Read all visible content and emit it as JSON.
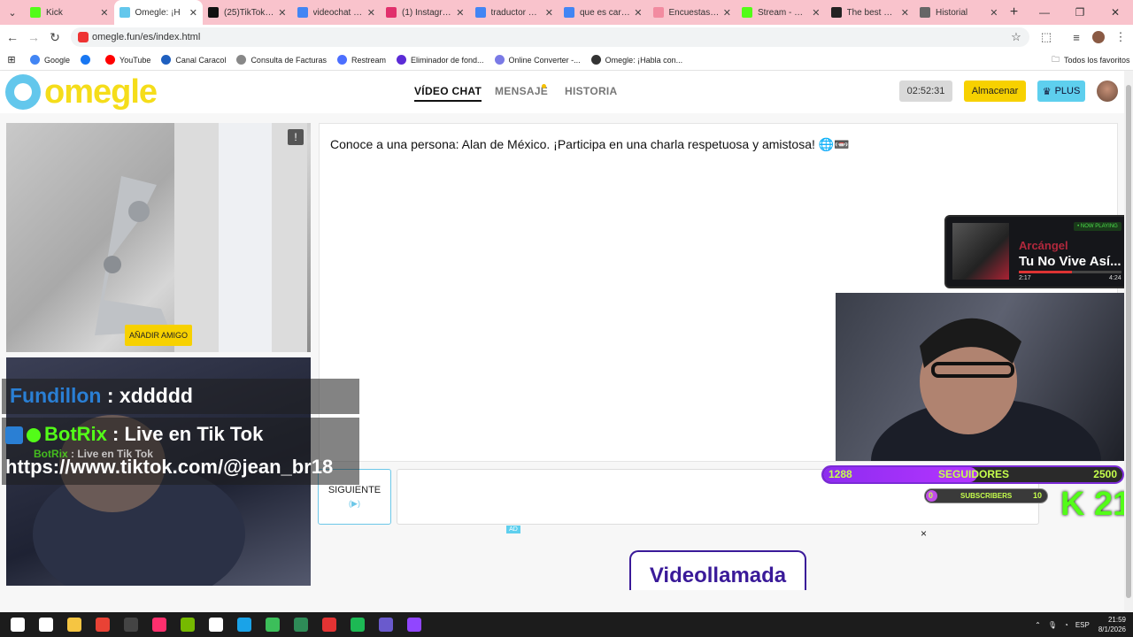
{
  "browser": {
    "tabs": [
      {
        "label": "Kick",
        "favicon_color": "#53fc18"
      },
      {
        "label": "Omegle: ¡H",
        "favicon_color": "#63c7ec",
        "active": true
      },
      {
        "label": "(25)TikTok - M",
        "favicon_color": "#111111"
      },
      {
        "label": "videochat - Bu",
        "favicon_color": "#4285f4"
      },
      {
        "label": "(1) Instagram",
        "favicon_color": "#e1306c"
      },
      {
        "label": "traductor de in",
        "favicon_color": "#4285f4"
      },
      {
        "label": "que es carbon",
        "favicon_color": "#4285f4"
      },
      {
        "label": "Encuestas en K",
        "favicon_color": "#f28ba0"
      },
      {
        "label": "Stream - Kick D",
        "favicon_color": "#53fc18"
      },
      {
        "label": "The best ChatB",
        "favicon_color": "#222222"
      },
      {
        "label": "Historial",
        "favicon_color": "#666666"
      }
    ],
    "url": "omegle.fun/es/index.html",
    "bookmarks": [
      {
        "label": "Google",
        "color": "#4285f4"
      },
      {
        "label": "",
        "color": "#1877f2"
      },
      {
        "label": "YouTube",
        "color": "#ff0000"
      },
      {
        "label": "Canal Caracol",
        "color": "#1f5fbf"
      },
      {
        "label": "Consulta de Facturas",
        "color": "#888888"
      },
      {
        "label": "Restream",
        "color": "#4c6fff"
      },
      {
        "label": "Eliminador de fond...",
        "color": "#5b2bd6"
      },
      {
        "label": "Online Converter -...",
        "color": "#7a7ae6"
      },
      {
        "label": "Omegle: ¡Habla con...",
        "color": "#333333"
      }
    ],
    "all_bookmarks_label": "Todos los favoritos"
  },
  "site": {
    "logo_text": "omegle",
    "nav": [
      {
        "label": "VÍDEO CHAT",
        "active": true
      },
      {
        "label": "MENSAJE",
        "active": false
      },
      {
        "label": "HISTORIA",
        "active": false
      }
    ],
    "timer": "02:52:31",
    "save_label": "Almacenar",
    "plus_label": "PLUS"
  },
  "chat": {
    "intro": "Conoce a una persona: Alan de México. ¡Participa en una charla respetuosa y amistosa! 🌐📼",
    "add_friend_label": "AÑADIR AMIGO",
    "next_label": "SIGUIENTE",
    "next_hint": "(▶)",
    "ad_tag": "AD",
    "ad_close": "×",
    "ad_text": "Videollamada"
  },
  "stream_overlay": {
    "chat_lines": [
      {
        "user": "Fundillon",
        "text": " : xddddd",
        "user_color": "#2a7fd4"
      },
      {
        "user": "BotRix",
        "text": " : Live en Tik Tok",
        "user_color": "#53fc18"
      },
      {
        "user": "BotRix",
        "text": " : Live en Tik Tok",
        "user_color": "#53fc18"
      },
      {
        "user": "",
        "text": "https://www.tiktok.com/@jean_br18",
        "user_color": "#ffffff"
      }
    ],
    "now_playing": {
      "tag": "• NOW PLAYING",
      "artist": "Arcángel",
      "title": "Tu No Vive Así...",
      "elapsed": "2:17",
      "total": "4:24",
      "progress": 0.52
    },
    "followers": {
      "current": "1288",
      "label": "SEGUIDORES",
      "goal": "2500",
      "progress": 0.515
    },
    "subs": {
      "current": "0",
      "label": "SUBSCRIBERS",
      "goal": "10"
    },
    "kick_brand": "K 21"
  },
  "taskbar": {
    "apps": [
      {
        "name": "start",
        "color": "#ffffff"
      },
      {
        "name": "search",
        "color": "#ffffff"
      },
      {
        "name": "explorer",
        "color": "#f5c542"
      },
      {
        "name": "chrome",
        "color": "#e94235"
      },
      {
        "name": "cod",
        "color": "#444444"
      },
      {
        "name": "tiktok",
        "color": "#ff2f6d"
      },
      {
        "name": "nvidia",
        "color": "#76b900"
      },
      {
        "name": "tf",
        "color": "#ffffff"
      },
      {
        "name": "edge",
        "color": "#1aa3e8"
      },
      {
        "name": "app-green",
        "color": "#3cbf5a"
      },
      {
        "name": "terminal",
        "color": "#2e8b57"
      },
      {
        "name": "obs",
        "color": "#e33333"
      },
      {
        "name": "spotify",
        "color": "#1db954"
      },
      {
        "name": "discord",
        "color": "#6a5acd"
      },
      {
        "name": "twitch",
        "color": "#9146ff"
      }
    ],
    "lang": "ESP",
    "time": "21:59",
    "date": "8/1/2026"
  }
}
